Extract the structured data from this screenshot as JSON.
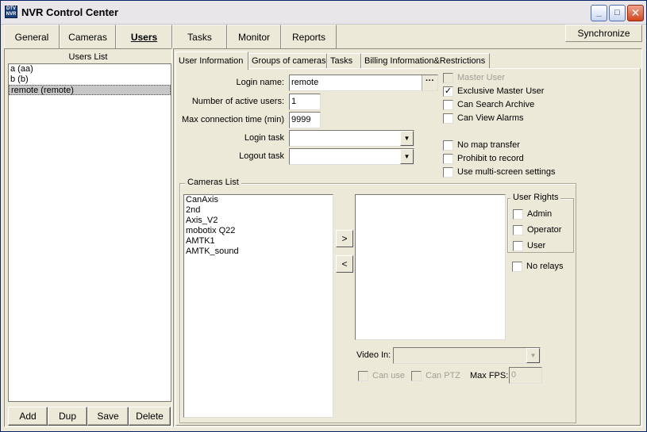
{
  "window": {
    "title": "NVR Control Center",
    "icon_label": "DTV NVR",
    "controls": {
      "minimize": "_",
      "maximize": "□",
      "close": "✕"
    }
  },
  "top_tabs": [
    "General",
    "Cameras",
    "Users",
    "Tasks",
    "Monitor",
    "Reports"
  ],
  "active_top_tab": "Users",
  "synchronize_label": "Synchronize",
  "users_panel": {
    "title": "Users List",
    "items": [
      "a (aa)",
      "b (b)",
      "remote (remote)"
    ],
    "selected_index": 2,
    "buttons": {
      "add": "Add",
      "dup": "Dup",
      "save": "Save",
      "delete": "Delete"
    }
  },
  "sub_tabs": [
    "User Information",
    "Groups of cameras",
    "Tasks",
    "Billing Information&Restrictions"
  ],
  "active_sub_tab": "User Information",
  "form": {
    "login_name_label": "Login name:",
    "login_name_value": "remote",
    "browse_label": "···",
    "active_users_label": "Number of active users:",
    "active_users_value": "1",
    "max_conn_label": "Max connection time (min)",
    "max_conn_value": "9999",
    "login_task_label": "Login task",
    "login_task_value": "",
    "logout_task_label": "Logout task",
    "logout_task_value": ""
  },
  "options": {
    "master_user": {
      "label": "Master User",
      "checked": false,
      "disabled": true
    },
    "exclusive_master_user": {
      "label": "Exclusive Master User",
      "checked": true
    },
    "can_search_archive": {
      "label": "Can Search Archive",
      "checked": false
    },
    "can_view_alarms": {
      "label": "Can View Alarms",
      "checked": false
    },
    "no_map_transfer": {
      "label": "No map transfer",
      "checked": false
    },
    "prohibit_to_record": {
      "label": "Prohibit to record",
      "checked": false
    },
    "use_multiscreen": {
      "label": "Use multi-screen settings",
      "checked": false
    }
  },
  "cameras": {
    "title": "Cameras List",
    "available": [
      "CanAxis",
      "2nd",
      "Axis_V2",
      "mobotix Q22",
      "AMTK1",
      "AMTK_sound"
    ],
    "assigned": [],
    "add_label": ">",
    "remove_label": "<",
    "user_rights_title": "User Rights",
    "rights": {
      "admin": "Admin",
      "operator": "Operator",
      "user": "User"
    },
    "no_relays": "No relays",
    "video_in_label": "Video In:",
    "video_in_value": "",
    "can_use_label": "Can use",
    "can_ptz_label": "Can PTZ",
    "max_fps_label": "Max FPS:",
    "max_fps_value": "0"
  }
}
